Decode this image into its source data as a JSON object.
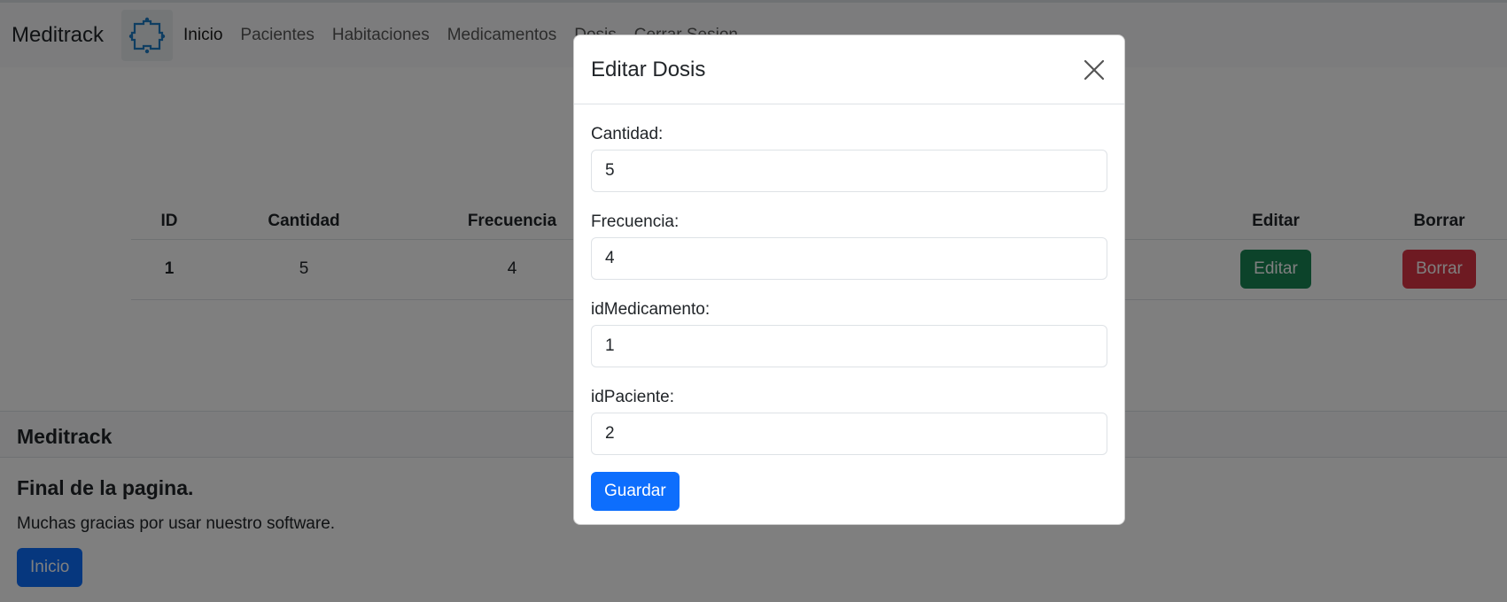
{
  "navbar": {
    "brand": "Meditrack",
    "links": [
      "Inicio",
      "Pacientes",
      "Habitaciones",
      "Medicamentos",
      "Dosis",
      "Cerrar Sesion"
    ]
  },
  "table": {
    "headers": [
      "ID",
      "Cantidad",
      "Frecuencia",
      "Editar",
      "Borrar"
    ],
    "rows": [
      {
        "id": "1",
        "cantidad": "5",
        "frecuencia": "4",
        "edit_label": "Editar",
        "delete_label": "Borrar"
      }
    ]
  },
  "footer": {
    "header": "Meditrack",
    "title": "Final de la pagina.",
    "text": "Muchas gracias por usar nuestro software.",
    "button_label": "Inicio"
  },
  "modal": {
    "title": "Editar Dosis",
    "fields": [
      {
        "label": "Cantidad:",
        "value": "5"
      },
      {
        "label": "Frecuencia:",
        "value": "4"
      },
      {
        "label": "idMedicamento:",
        "value": "1"
      },
      {
        "label": "idPaciente:",
        "value": "2"
      }
    ],
    "save_label": "Guardar"
  },
  "colors": {
    "primary": "#0d6efd",
    "success": "#198754",
    "danger": "#dc3545",
    "logo": "#1f7cc4"
  },
  "icons": [
    "puzzle-logo-icon",
    "close-icon"
  ]
}
